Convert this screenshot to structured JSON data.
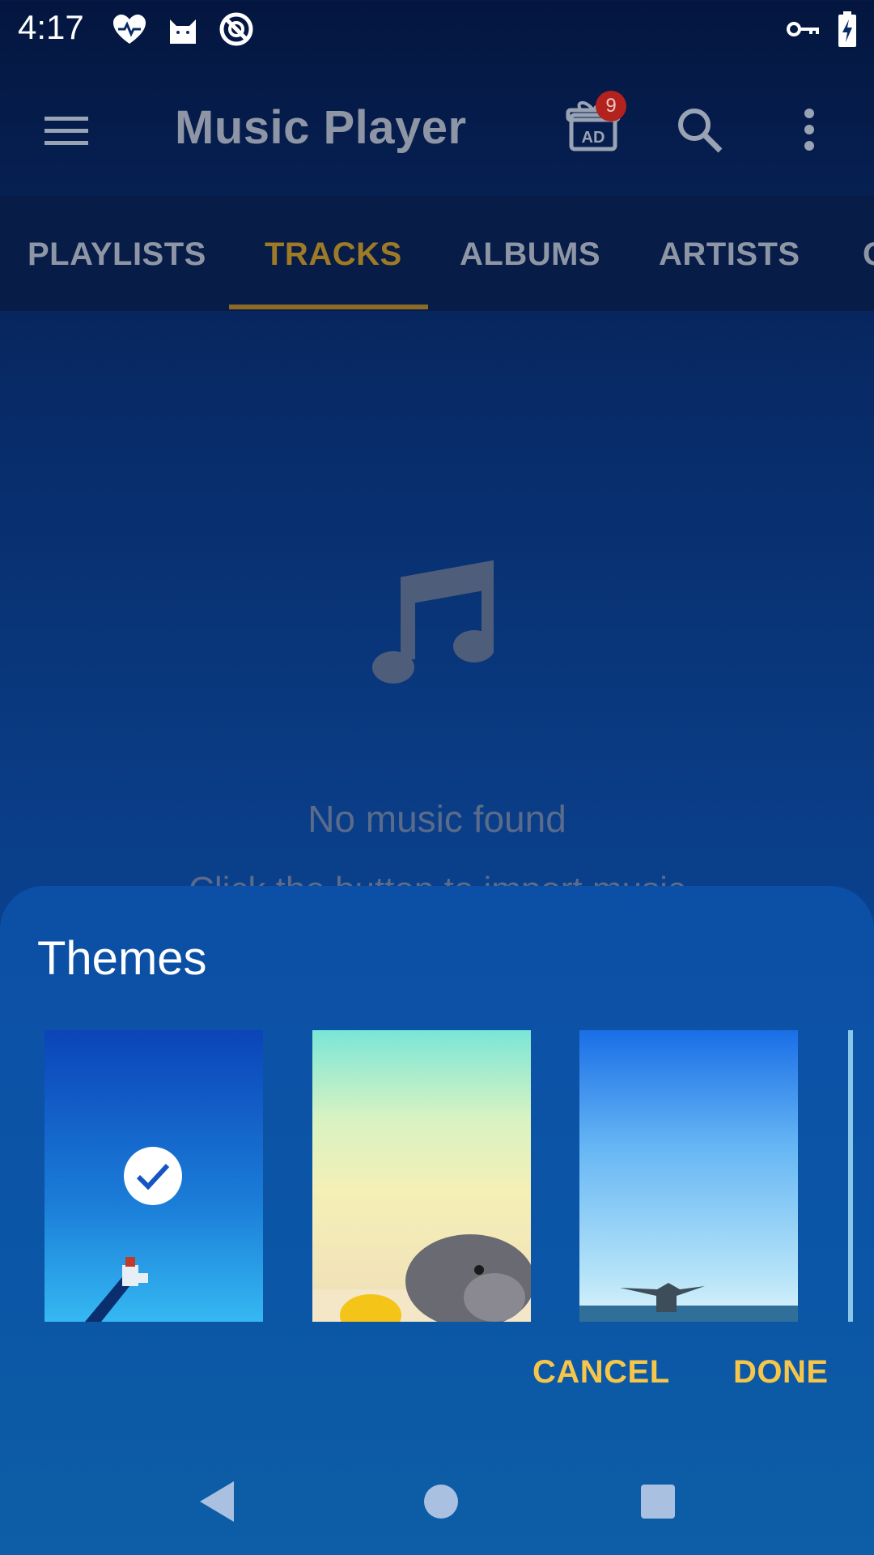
{
  "status_bar": {
    "time": "4:17",
    "left_icons": [
      "heart-pulse-icon",
      "cat-icon",
      "no-distraction-icon"
    ],
    "right_icons": [
      "vpn-key-icon",
      "battery-charging-icon"
    ]
  },
  "app_bar": {
    "title": "Music Player",
    "ad_badge_count": "9",
    "ad_label": "AD"
  },
  "tabs": [
    {
      "label": "PLAYLISTS",
      "active": false
    },
    {
      "label": "TRACKS",
      "active": true
    },
    {
      "label": "ALBUMS",
      "active": false
    },
    {
      "label": "ARTISTS",
      "active": false
    },
    {
      "label": "G",
      "active": false
    }
  ],
  "empty_state": {
    "title": "No music found",
    "subtitle": "Click the button to import music"
  },
  "themes_sheet": {
    "title": "Themes",
    "themes": [
      {
        "name": "blue-lighthouse",
        "selected": true
      },
      {
        "name": "guinea-pig-flower",
        "selected": false
      },
      {
        "name": "whale-tail-sea",
        "selected": false
      }
    ],
    "cancel_label": "CANCEL",
    "done_label": "DONE"
  },
  "colors": {
    "accent": "#f6c64a",
    "tab_active": "#9e7a27",
    "badge": "#b3221c"
  }
}
